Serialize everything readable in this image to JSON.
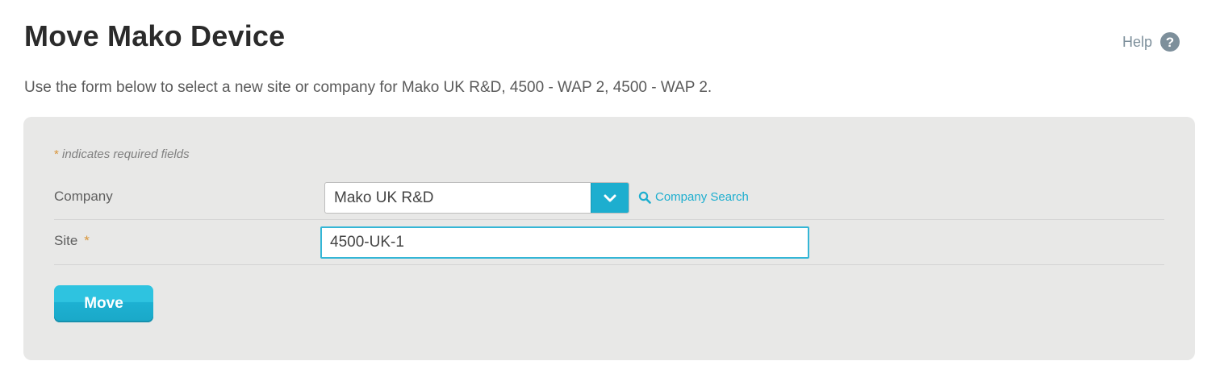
{
  "page": {
    "title": "Move Mako Device",
    "help_label": "Help",
    "help_icon": "?",
    "intro": "Use the form below to select a new site or company for Mako UK R&D, 4500 - WAP 2, 4500 - WAP 2."
  },
  "form": {
    "required_star": "*",
    "required_note": " indicates required fields",
    "company": {
      "label": "Company",
      "selected_value": "Mako UK R&D",
      "toggle_icon": "chevron-down-icon",
      "search_label": "Company Search",
      "search_icon": "search-icon"
    },
    "site": {
      "label": "Site",
      "required_star": "*",
      "value": "4500-UK-1"
    },
    "submit_label": "Move"
  },
  "colors": {
    "accent": "#1daecf",
    "required": "#d9963c",
    "panel_bg": "#e8e8e7",
    "help": "#7d8f9b"
  }
}
